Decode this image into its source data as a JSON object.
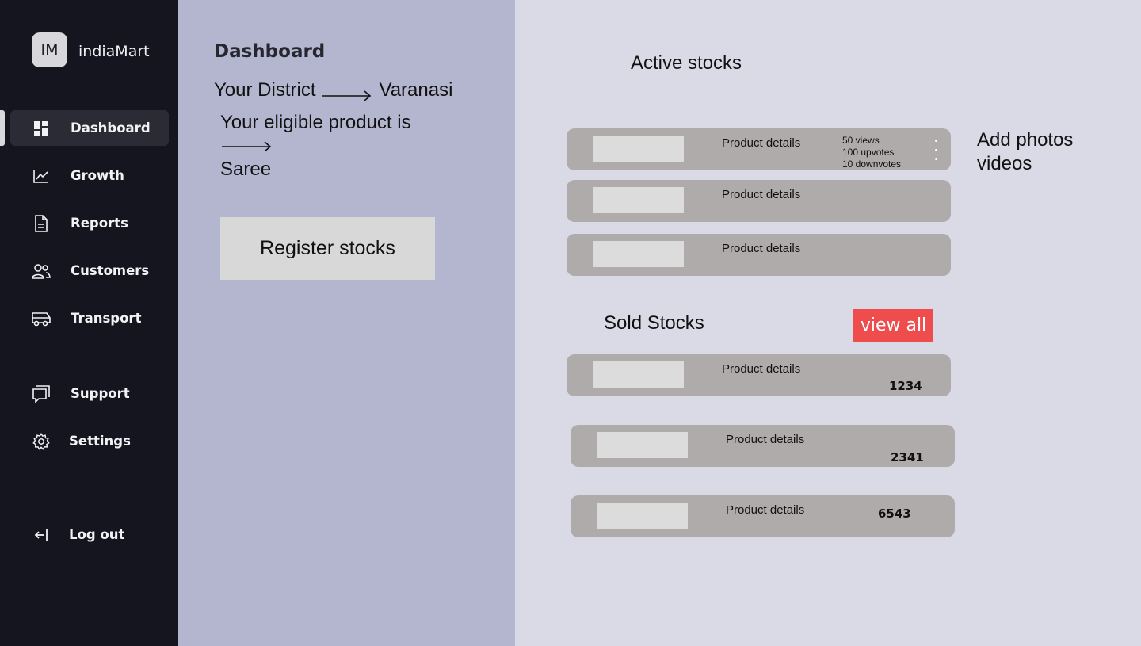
{
  "sidebar": {
    "logo_initials": "IM",
    "brand": "indiaMart",
    "items": [
      {
        "label": "Dashboard",
        "icon": "dashboard-icon"
      },
      {
        "label": "Growth",
        "icon": "growth-chart-icon"
      },
      {
        "label": "Reports",
        "icon": "document-icon"
      },
      {
        "label": "Customers",
        "icon": "users-icon"
      },
      {
        "label": "Transport",
        "icon": "bus-icon"
      },
      {
        "label": "Support",
        "icon": "chat-icon"
      },
      {
        "label": "Settings",
        "icon": "gear-icon"
      },
      {
        "label": "Log out",
        "icon": "logout-icon"
      }
    ]
  },
  "middle": {
    "title": "Dashboard",
    "district_label": "Your District",
    "district_value": "Varanasi",
    "eligible_label": "Your eligible product is",
    "eligible_value": "Saree",
    "register_button": "Register stocks"
  },
  "active_stocks": {
    "title": "Active stocks",
    "items": [
      {
        "label": "Product details",
        "views": "50 views",
        "upvotes": "100 upvotes",
        "downvotes": "10 downvotes"
      },
      {
        "label": "Product details"
      },
      {
        "label": "Product details"
      }
    ],
    "add_media_label": "Add photos videos"
  },
  "sold_stocks": {
    "title": "Sold Stocks",
    "view_all": "view all",
    "items": [
      {
        "label": "Product details",
        "amount": "1234"
      },
      {
        "label": "Product details",
        "amount": "2341"
      },
      {
        "label": "Product details",
        "amount": "6543"
      }
    ]
  },
  "colors": {
    "sidebar_bg": "#151520",
    "middle_bg": "#b4b5cf",
    "right_bg": "#dadae6",
    "card_bg": "#afabaa",
    "view_all_bg": "#ef4d4d"
  }
}
